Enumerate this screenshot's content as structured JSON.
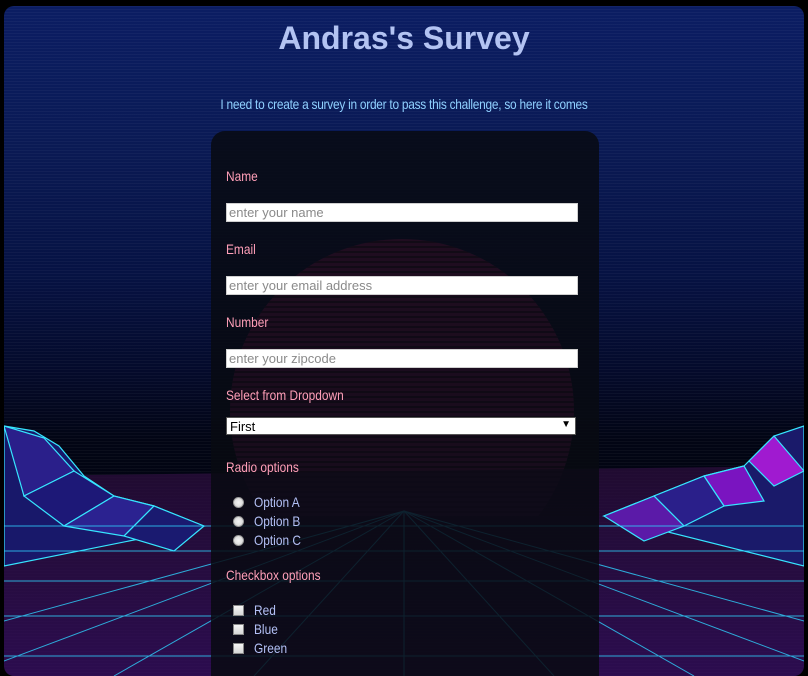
{
  "page": {
    "title": "Andras's Survey",
    "description": "I need to create a survey in order to pass this challenge, so here it comes"
  },
  "form": {
    "name_label": "Name",
    "name_placeholder": "enter your name",
    "email_label": "Email",
    "email_placeholder": "enter your email address",
    "number_label": "Number",
    "number_placeholder": "enter your zipcode",
    "dropdown_label": "Select from Dropdown",
    "dropdown_selected": "First",
    "radio_label": "Radio options",
    "radio_options": [
      "Option A",
      "Option B",
      "Option C"
    ],
    "checkbox_label": "Checkbox options",
    "checkbox_options": [
      "Red",
      "Blue",
      "Green"
    ]
  },
  "colors": {
    "title": "#b3c3f2",
    "label": "#ff9fb8",
    "option_text": "#b3c0f5",
    "description": "#8fd0ff",
    "card_bg": "#080a12",
    "sun": "#a0206e",
    "grid_line": "#2fd3ff"
  }
}
